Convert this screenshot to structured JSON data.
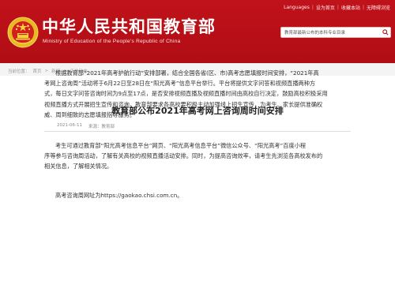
{
  "topbar": {
    "languages": "Languages",
    "separator": "|",
    "home": "设为首页",
    "favorite": "收藏本站",
    "barrier_free": "无障碍浏览"
  },
  "site": {
    "title": "中华人民共和国教育部",
    "subtitle": "Ministry of Education of the People's Republic of China",
    "accent_color": "#c0121a"
  },
  "search": {
    "value": "教育部最新公布的本科专业目录",
    "icon": "search-icon"
  },
  "breadcrumb": {
    "items": [
      "当前位置：",
      "首页",
      ">",
      "新闻",
      ">",
      "工作动态"
    ]
  },
  "article": {
    "title": "教育部公布2021年高考网上咨询周时间安排",
    "date": "2021-06-11",
    "source": "来源：教育部",
    "paragraphs": [
      [
        "根据教育部“2021年高考护航行动”安排部署，结合全国各省(区、市)高考志愿填报时间安排，“2021年高",
        "考网上咨询周”活动将于6月22日至28日在“阳光高考”信息平台举行。平台将提供文字问答和视频直播两种方",
        "式，每日文字问答咨询时间为9点至17点，是否安排视频直播及视频直播时间由高校自行决定，鼓励高校积极采用",
        "视频直播方式开展招生宣传和咨询。教育部要求各高校要积极主动加强线上招生宣传，为考生、家长提供准确权",
        "威、周到细致的志愿填报指导服务。"
      ],
      [
        "考生可通过教育部“阳光高考信息平台”网页、“阳光高考信息平台”微信公众号、“阳光高考”百度小程",
        "序等参与咨询周活动，了解有关高校的视频直播活动安排。同时，为提高咨询效率，请考生先浏览各高校发布的",
        "相关信息，了解相关情况。"
      ],
      [
        "高考咨询周网址为https://gaokao.chsi.com.cn。"
      ]
    ]
  }
}
